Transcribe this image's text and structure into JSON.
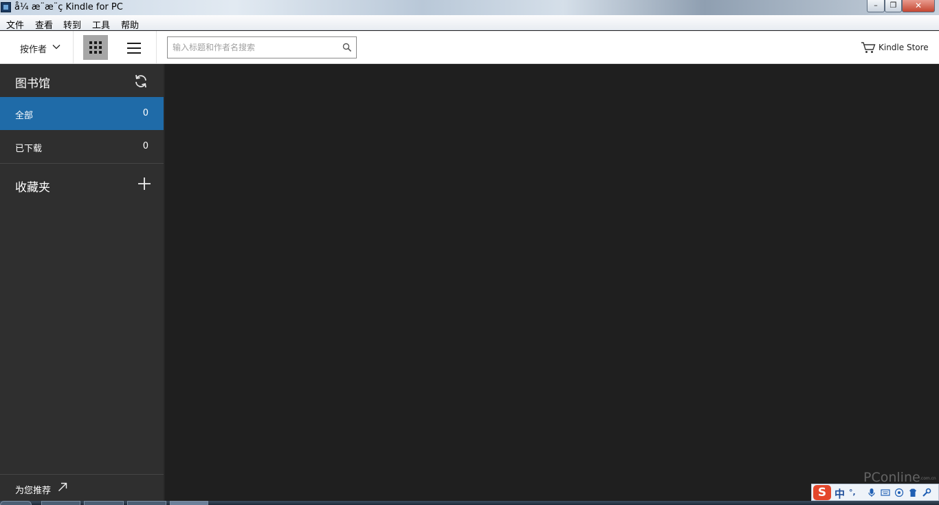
{
  "window": {
    "title": "å¼ æ¨æ¨ç Kindle for PC",
    "minimize_glyph": "–",
    "maximize_glyph": "❐",
    "close_glyph": "✕"
  },
  "menu": {
    "items": [
      "文件",
      "查看",
      "转到",
      "工具",
      "帮助"
    ]
  },
  "toolbar": {
    "sort_label": "按作者",
    "search_placeholder": "输入标题和作者名搜索",
    "search_value": "",
    "store_label": "Kindle Store"
  },
  "sidebar": {
    "library_title": "图书馆",
    "items": [
      {
        "label": "全部",
        "count": "0",
        "active": true
      },
      {
        "label": "已下载",
        "count": "0",
        "active": false
      }
    ],
    "favorites_title": "收藏夹",
    "recommend_label": "为您推荐"
  },
  "ime": {
    "logo": "S",
    "mode": "中",
    "punct": "°,"
  },
  "watermark": {
    "text": "PConline",
    "sub": ".com.cn"
  },
  "colors": {
    "sidebar_bg": "#2f2f2f",
    "main_bg": "#1f1f1f",
    "active_item": "#1f6ba8",
    "toolbar_bg": "#ffffff"
  }
}
